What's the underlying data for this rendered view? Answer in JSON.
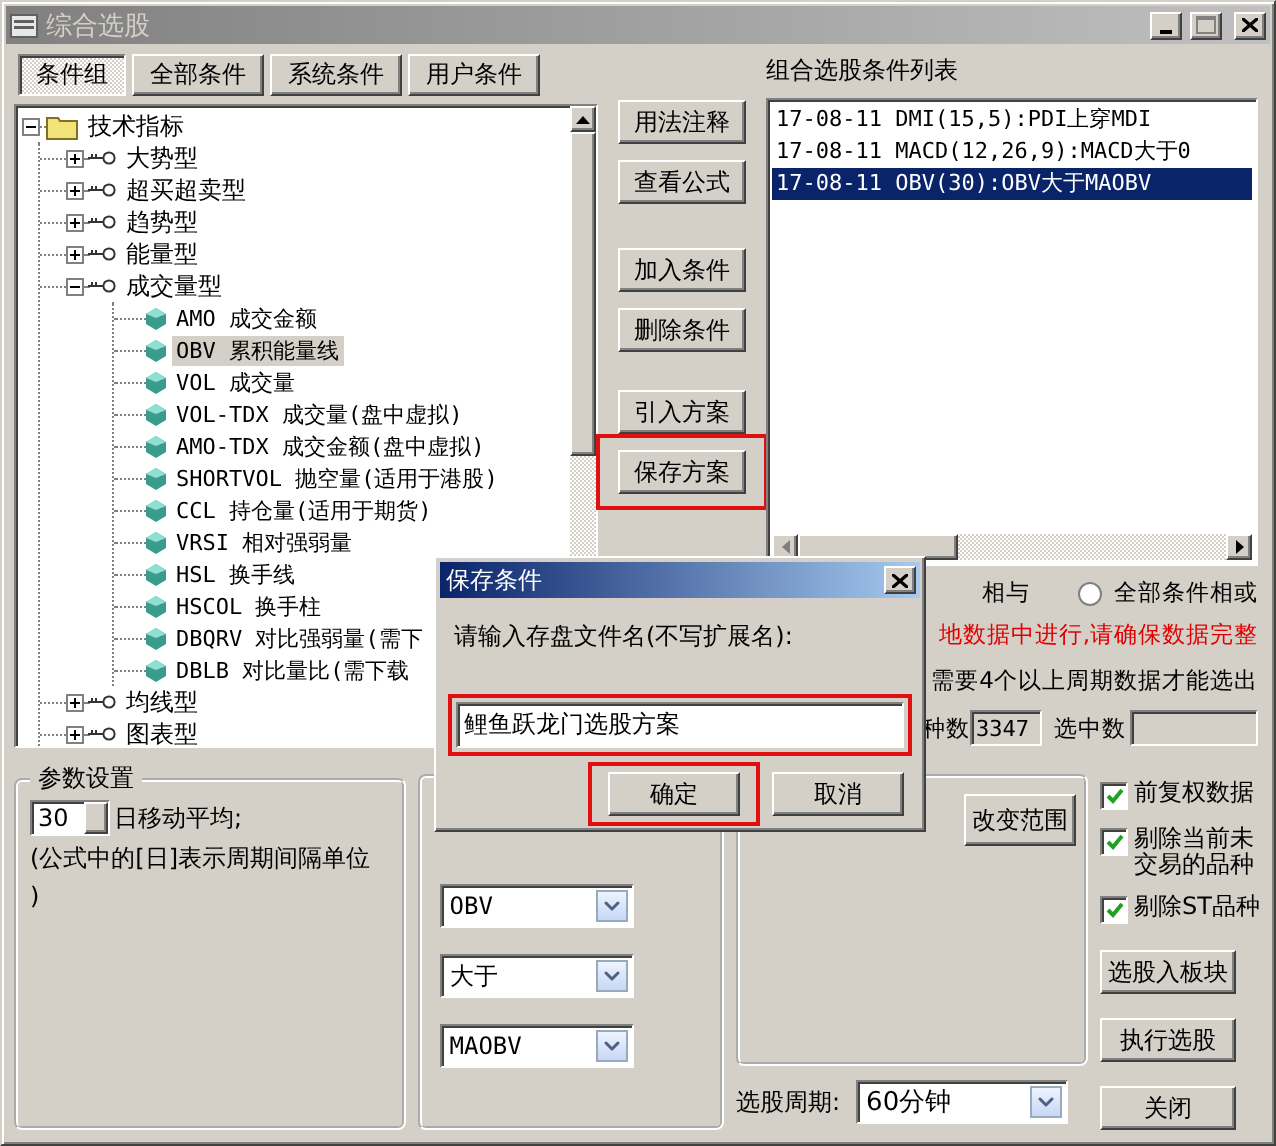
{
  "window": {
    "title": "综合选股"
  },
  "tabs": [
    {
      "label": "条件组",
      "selected": true
    },
    {
      "label": "全部条件",
      "selected": false
    },
    {
      "label": "系统条件",
      "selected": false
    },
    {
      "label": "用户条件",
      "selected": false
    }
  ],
  "tree": [
    {
      "label": "技术指标",
      "kind": "folder",
      "expanded": true,
      "children": [
        {
          "label": "大势型",
          "kind": "group",
          "expanded": false
        },
        {
          "label": "超买超卖型",
          "kind": "group",
          "expanded": false
        },
        {
          "label": "趋势型",
          "kind": "group",
          "expanded": false
        },
        {
          "label": "能量型",
          "kind": "group",
          "expanded": false
        },
        {
          "label": "成交量型",
          "kind": "group",
          "expanded": true,
          "children": [
            {
              "label": "AMO 成交金额",
              "kind": "formula",
              "selected": false
            },
            {
              "label": "OBV 累积能量线",
              "kind": "formula",
              "selected": true
            },
            {
              "label": "VOL 成交量",
              "kind": "formula",
              "selected": false
            },
            {
              "label": "VOL-TDX 成交量(盘中虚拟)",
              "kind": "formula",
              "selected": false
            },
            {
              "label": "AMO-TDX 成交金额(盘中虚拟)",
              "kind": "formula",
              "selected": false
            },
            {
              "label": "SHORTVOL 抛空量(适用于港股)",
              "kind": "formula",
              "selected": false
            },
            {
              "label": "CCL 持仓量(适用于期货)",
              "kind": "formula",
              "selected": false
            },
            {
              "label": "VRSI 相对强弱量",
              "kind": "formula",
              "selected": false
            },
            {
              "label": "HSL 换手线",
              "kind": "formula",
              "selected": false
            },
            {
              "label": "HSCOL 换手柱",
              "kind": "formula",
              "selected": false
            },
            {
              "label": "DBQRV 对比强弱量(需下",
              "kind": "formula",
              "selected": false
            },
            {
              "label": "DBLB 对比量比(需下载",
              "kind": "formula",
              "selected": false
            }
          ]
        },
        {
          "label": "均线型",
          "kind": "group",
          "expanded": false
        },
        {
          "label": "图表型",
          "kind": "group",
          "expanded": false
        }
      ]
    }
  ],
  "action_groups": [
    {
      "buttons": [
        {
          "label": "用法注释",
          "highlighted": false
        },
        {
          "label": "查看公式",
          "highlighted": false
        }
      ]
    },
    {
      "buttons": [
        {
          "label": "加入条件",
          "highlighted": false
        },
        {
          "label": "删除条件",
          "highlighted": false
        }
      ]
    },
    {
      "buttons": [
        {
          "label": "引入方案",
          "highlighted": false
        },
        {
          "label": "保存方案",
          "highlighted": true
        }
      ]
    }
  ],
  "condition_list": {
    "title": "组合选股条件列表",
    "items": [
      {
        "text": "17-08-11 DMI(15,5):PDI上穿MDI",
        "selected": false
      },
      {
        "text": "17-08-11 MACD(12,26,9):MACD大于0",
        "selected": false
      },
      {
        "text": "17-08-11 OBV(30):OBV大于MAOBV",
        "selected": true
      }
    ]
  },
  "logic": {
    "fragment": "相与",
    "radio": {
      "label": "全部条件相或",
      "selected": false
    }
  },
  "notices": [
    {
      "text": "地数据中进行,请确保数据完整",
      "kind": "warning"
    },
    {
      "text": "需要4个以上周期数据才能选出",
      "kind": "info"
    }
  ],
  "counts": {
    "total_label": "种数",
    "total": "3347",
    "selected_label": "选中数"
  },
  "params": {
    "title": "参数设置",
    "period": "30",
    "period_label": "日移动平均;",
    "note_lines": [
      "(公式中的[日]表示周期间隔单位",
      ")"
    ]
  },
  "selectors": [
    {
      "value": "OBV"
    },
    {
      "value": "大于"
    },
    {
      "value": "MAOBV"
    }
  ],
  "range_button": "改变范围",
  "options": [
    {
      "label": "前复权数据",
      "checked": true
    },
    {
      "label": "剔除当前未交易的品种",
      "checked": true
    },
    {
      "label": "剔除ST品种",
      "checked": true
    }
  ],
  "side_buttons": [
    "选股入板块",
    "执行选股"
  ],
  "period": {
    "label": "选股周期:",
    "value": "60分钟"
  },
  "close_button": "关闭",
  "dialog": {
    "title": "保存条件",
    "prompt": "请输入存盘文件名(不写扩展名):",
    "value": "鲤鱼跃龙门选股方案",
    "input_highlighted": true,
    "buttons": [
      {
        "label": "确定",
        "highlighted": true
      },
      {
        "label": "取消",
        "highlighted": false
      }
    ]
  }
}
